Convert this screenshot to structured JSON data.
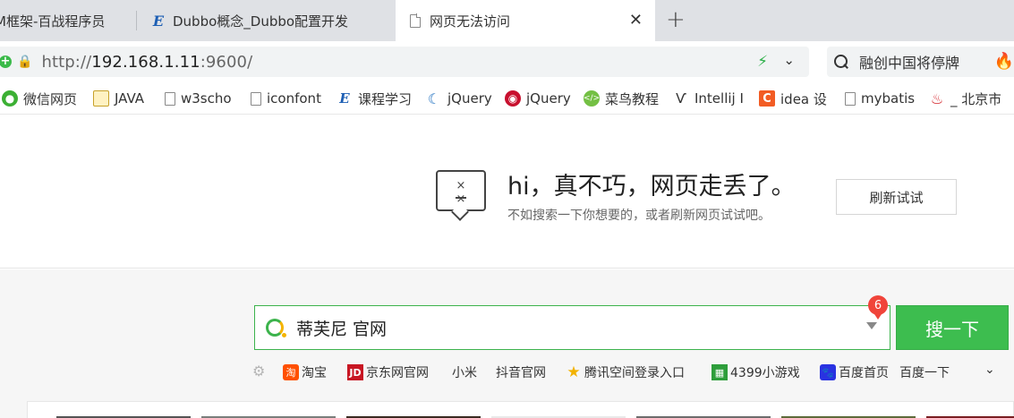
{
  "tabs": [
    {
      "label": "M框架-百战程序员",
      "active": false
    },
    {
      "label": "Dubbo概念_Dubbo配置开发",
      "active": false
    },
    {
      "label": "网页无法访问",
      "active": true
    }
  ],
  "tab_close_glyph": "✕",
  "new_tab_glyph": "+",
  "address": {
    "scheme": "http://",
    "host": "192.168.1.11",
    "port_path": ":9600/"
  },
  "search_hint": "融创中国将停牌",
  "bookmarks": [
    {
      "label": "微信网页",
      "icon": "wechat-icon"
    },
    {
      "label": "JAVA",
      "icon": "folder-icon"
    },
    {
      "label": "w3scho",
      "icon": "doc-icon"
    },
    {
      "label": "iconfont",
      "icon": "doc-icon"
    },
    {
      "label": "课程学习",
      "icon": "e-icon"
    },
    {
      "label": "jQuery",
      "icon": "jquery-icon"
    },
    {
      "label": "jQuery",
      "icon": "jquery-red-icon"
    },
    {
      "label": "菜鸟教程",
      "icon": "runoob-icon"
    },
    {
      "label": "Intellij I",
      "icon": "intellij-icon"
    },
    {
      "label": "idea 设",
      "icon": "c-icon"
    },
    {
      "label": "mybatis",
      "icon": "doc-icon"
    },
    {
      "label": "_ 北京市",
      "icon": "beijing-icon"
    }
  ],
  "error": {
    "title": "hi，真不巧，网页走丢了。",
    "subtitle": "不如搜索一下你想要的，或者刷新网页试试吧。",
    "refresh_label": "刷新试试",
    "face_eyes": "× ×"
  },
  "search": {
    "query": "蒂芙尼 官网",
    "badge_count": "6",
    "button_label": "搜一下"
  },
  "hotlinks": [
    {
      "label": "淘宝",
      "icon": "taobao-icon",
      "glyph": "淘"
    },
    {
      "label": "京东网官网",
      "icon": "jd-icon",
      "glyph": "JD"
    },
    {
      "label": "小米",
      "icon": "",
      "glyph": ""
    },
    {
      "label": "抖音官网",
      "icon": "",
      "glyph": ""
    },
    {
      "label": "腾讯空间登录入口",
      "icon": "star-icon",
      "glyph": "★"
    },
    {
      "label": "4399小游戏",
      "icon": "4399-icon",
      "glyph": "▦"
    },
    {
      "label": "百度首页",
      "icon": "baidu-icon",
      "glyph": "🐾"
    },
    {
      "label": "百度一下",
      "icon": "",
      "glyph": ""
    }
  ],
  "colors": {
    "accent_green": "#3dbd4f",
    "badge_red": "#f0443a",
    "tab_strip": "#dfe1e5"
  }
}
